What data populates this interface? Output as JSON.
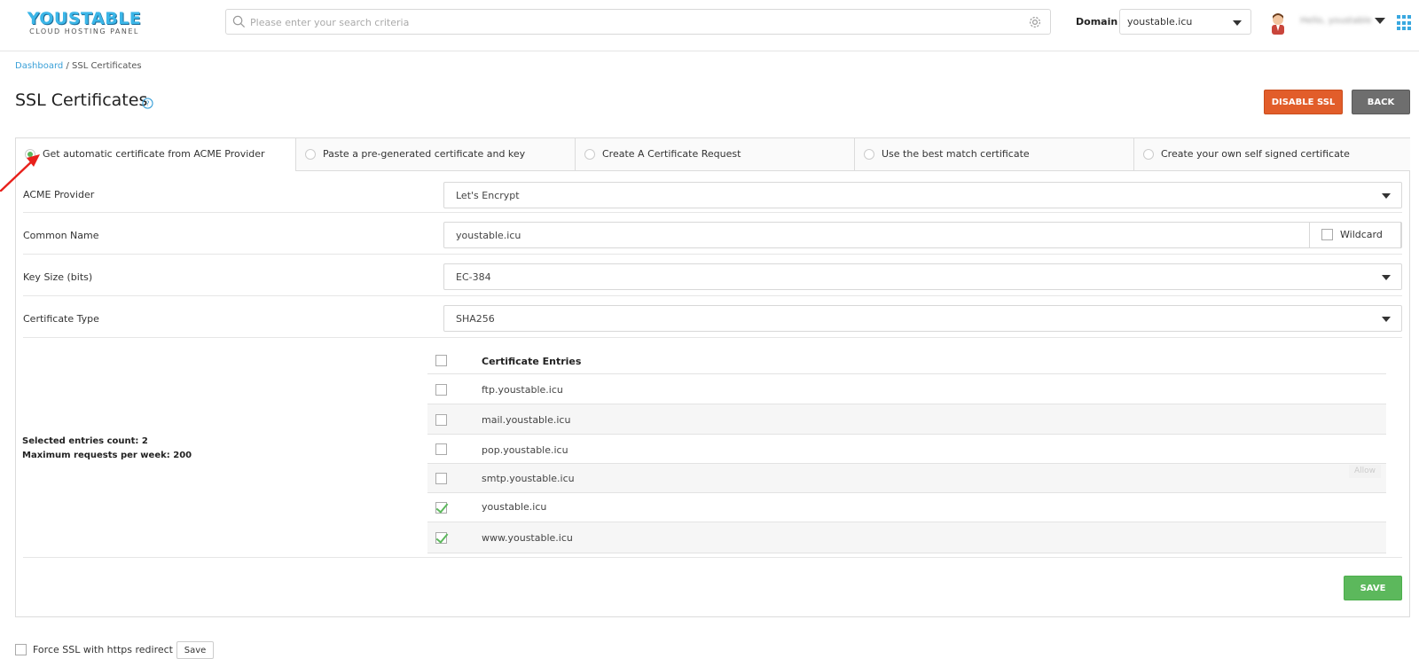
{
  "header": {
    "logo_main": "YOUSTABLE",
    "logo_sub": "CLOUD HOSTING PANEL",
    "search_placeholder": "Please enter your search criteria",
    "domain_label": "Domain",
    "domain_value": "youstable.icu",
    "username": "Hello, youstable"
  },
  "breadcrumb": {
    "link": "Dashboard",
    "separator": " / ",
    "current": "SSL Certificates"
  },
  "page_title": "SSL Certificates",
  "buttons": {
    "disable_ssl": "DISABLE SSL",
    "back": "BACK",
    "save": "SAVE"
  },
  "tabs": [
    {
      "label": "Get automatic certificate from ACME Provider",
      "active": true
    },
    {
      "label": "Paste a pre-generated certificate and key",
      "active": false
    },
    {
      "label": "Create A Certificate Request",
      "active": false
    },
    {
      "label": "Use the best match certificate",
      "active": false
    },
    {
      "label": "Create your own self signed certificate",
      "active": false
    }
  ],
  "form": {
    "acme_provider": {
      "label": "ACME Provider",
      "value": "Let's Encrypt"
    },
    "common_name": {
      "label": "Common Name",
      "value": "youstable.icu",
      "wildcard_label": "Wildcard"
    },
    "key_size": {
      "label": "Key Size (bits)",
      "value": "EC-384"
    },
    "certificate_type": {
      "label": "Certificate Type",
      "value": "SHA256"
    }
  },
  "entries": {
    "header": "Certificate Entries",
    "items": [
      {
        "name": "ftp.youstable.icu",
        "checked": false
      },
      {
        "name": "mail.youstable.icu",
        "checked": false
      },
      {
        "name": "pop.youstable.icu",
        "checked": false
      },
      {
        "name": "smtp.youstable.icu",
        "checked": false
      },
      {
        "name": "youstable.icu",
        "checked": true
      },
      {
        "name": "www.youstable.icu",
        "checked": true
      }
    ]
  },
  "summary": {
    "selected": "Selected entries count: 2",
    "max": "Maximum requests per week: 200"
  },
  "allow_tag": "Allow",
  "force_ssl": {
    "label": "Force SSL with https redirect",
    "button": "Save"
  },
  "colors": {
    "accent": "#3aa0d8",
    "disable": "#e25d2a",
    "save": "#5cb85c",
    "back": "#6e6e6e",
    "annotation_arrow": "#e8201b"
  }
}
